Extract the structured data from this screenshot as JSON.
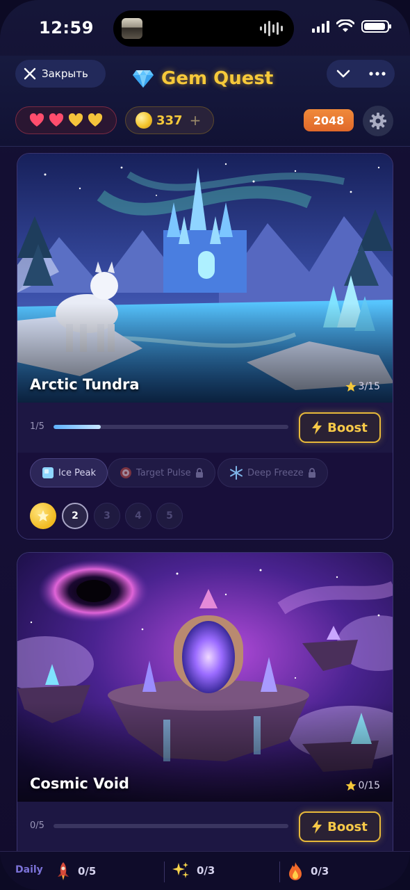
{
  "status_bar": {
    "time": "12:59"
  },
  "header": {
    "close_label": "Закрыть",
    "title": "Gem Quest",
    "lives": {
      "filled_red": 2,
      "filled_gold": 2
    },
    "coins": "337",
    "coins_plus": "+",
    "score": "2048"
  },
  "cards": [
    {
      "name": "Arctic Tundra",
      "stars": "3/15",
      "progress_label": "1/5",
      "progress": 0.2,
      "boost_label": "Boost",
      "skills": [
        {
          "label": "Ice Peak",
          "locked": false
        },
        {
          "label": "Target Pulse",
          "locked": true
        },
        {
          "label": "Deep Freeze",
          "locked": true
        }
      ],
      "levels": [
        "",
        "2",
        "3",
        "4",
        "5"
      ]
    },
    {
      "name": "Cosmic Void",
      "stars": "0/15",
      "progress_label": "0/5",
      "progress": 0,
      "boost_label": "Boost"
    }
  ],
  "bottom_bar": {
    "label": "Daily",
    "quests": [
      {
        "icon": "rocket-icon",
        "value": "0/5"
      },
      {
        "icon": "sparkles-icon",
        "value": "0/3"
      },
      {
        "icon": "fire-icon",
        "value": "0/3"
      }
    ]
  },
  "colors": {
    "accent_gold": "#f6c93a",
    "score_orange": "#e0682a",
    "progress_blue": "#5fb2ff"
  }
}
